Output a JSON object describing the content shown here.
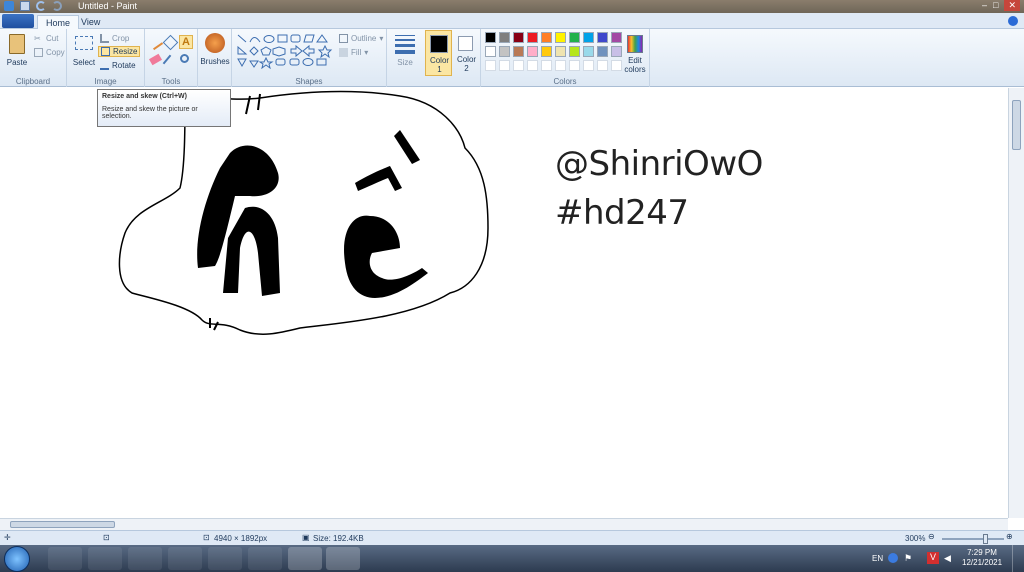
{
  "window": {
    "title": "Untitled - Paint"
  },
  "tabs": [
    {
      "label": "Home",
      "active": true
    },
    {
      "label": "View",
      "active": false
    }
  ],
  "ribbon": {
    "clipboard": {
      "paste": "Paste",
      "cut": "Cut",
      "copy": "Copy",
      "group": "Clipboard"
    },
    "image": {
      "select": "Select",
      "crop": "Crop",
      "resize": "Resize",
      "rotate": "Rotate",
      "group": "Image"
    },
    "tools": {
      "group": "Tools"
    },
    "brushes": {
      "label": "Brushes"
    },
    "shapes": {
      "outline": "Outline",
      "fill": "Fill",
      "group": "Shapes"
    },
    "size": {
      "label": "Size"
    },
    "color1": {
      "label": "Color",
      "num": "1",
      "value": "#000000"
    },
    "color2": {
      "label": "Color",
      "num": "2",
      "value": "#ffffff"
    },
    "colors": {
      "group": "Colors",
      "edit_line1": "Edit",
      "edit_line2": "colors",
      "row1": [
        "#000000",
        "#7f7f7f",
        "#880015",
        "#ed1c24",
        "#ff7f27",
        "#fff200",
        "#22b14c",
        "#00a2e8",
        "#3f48cc",
        "#a349a4"
      ],
      "row2": [
        "#ffffff",
        "#c3c3c3",
        "#b97a57",
        "#ffaec9",
        "#ffc90e",
        "#efe4b0",
        "#b5e61d",
        "#99d9ea",
        "#7092be",
        "#c8bfe7"
      ]
    }
  },
  "tooltip": {
    "title": "Resize and skew (Ctrl+W)",
    "body": "Resize and skew the picture or selection."
  },
  "canvas": {
    "text1": "@ShinriOwO",
    "text2": "#hd247"
  },
  "status": {
    "dimensions": "4940 × 1892px",
    "size": "Size: 192.4KB",
    "zoom": "300%",
    "zoom_level": 0.72
  },
  "taskbar": {
    "lang": "EN",
    "time": "7:29 PM",
    "date": "12/21/2021"
  },
  "icons": [
    "paste-icon",
    "cut-icon",
    "copy-icon",
    "select-icon",
    "crop-icon",
    "resize-icon",
    "rotate-icon",
    "pencil-icon",
    "fill-icon",
    "text-icon",
    "eraser-icon",
    "color-picker-icon",
    "magnifier-icon",
    "brushes-icon",
    "size-icon",
    "edit-colors-icon",
    "start-icon"
  ]
}
